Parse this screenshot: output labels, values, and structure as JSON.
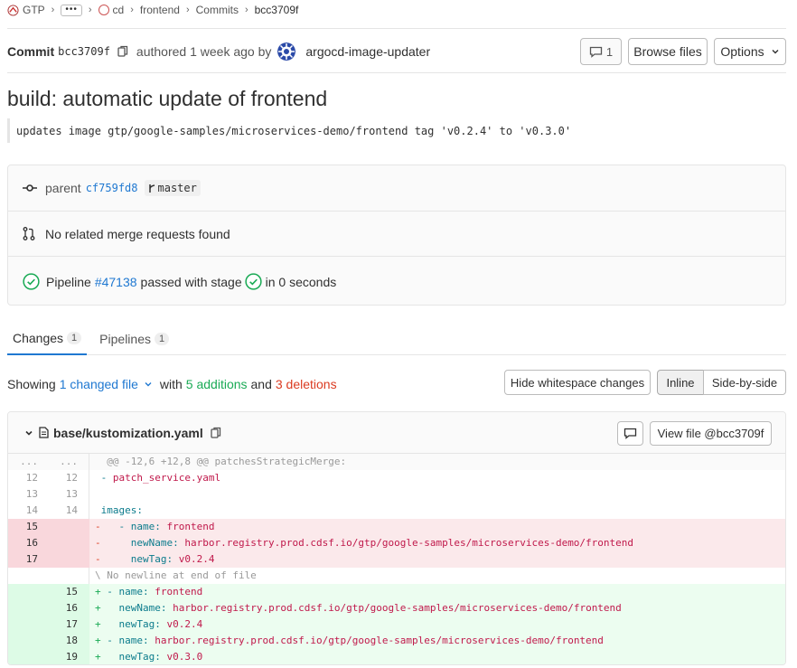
{
  "breadcrumb": {
    "group": "GTP",
    "ellipsis": "•••",
    "project_owner": "cd",
    "project": "frontend",
    "section": "Commits",
    "current": "bcc3709f"
  },
  "commit": {
    "label": "Commit",
    "sha": "bcc3709f",
    "authored": "authored 1 week ago by",
    "author": "argocd-image-updater",
    "comments_count": "1",
    "browse_files": "Browse files",
    "options": "Options",
    "title": "build: automatic update of frontend",
    "description": "updates image gtp/google-samples/microservices-demo/frontend tag 'v0.2.4' to 'v0.3.0'"
  },
  "info": {
    "parent_label": "parent",
    "parent_sha": "cf759fd8",
    "branch": "master",
    "merge_requests": "No related merge requests found",
    "pipeline_prefix": "Pipeline",
    "pipeline_id": "#47138",
    "pipeline_mid": "passed with stage",
    "pipeline_suffix": "in 0 seconds"
  },
  "tabs": [
    {
      "label": "Changes",
      "count": "1"
    },
    {
      "label": "Pipelines",
      "count": "1"
    }
  ],
  "summary": {
    "showing": "Showing",
    "changed_files": "1 changed file",
    "with": "with",
    "additions": "5 additions",
    "and": "and",
    "deletions": "3 deletions",
    "hide_whitespace": "Hide whitespace changes",
    "inline": "Inline",
    "side_by_side": "Side-by-side"
  },
  "file": {
    "path": "base/kustomization.yaml",
    "view_file": "View file @bcc3709f"
  },
  "diff": {
    "hunk_header": "@@ -12,6 +12,8 @@ patchesStrategicMerge:",
    "no_newline": "\\ No newline at end of file",
    "lines": [
      {
        "type": "match",
        "old": "...",
        "new": "...",
        "sign": "",
        "key": "",
        "val": ""
      },
      {
        "type": "context",
        "old": "12",
        "new": "12",
        "sign": "",
        "key": "- ",
        "val": "patch_service.yaml"
      },
      {
        "type": "context",
        "old": "13",
        "new": "13",
        "sign": "",
        "key": "",
        "val": ""
      },
      {
        "type": "context",
        "old": "14",
        "new": "14",
        "sign": "",
        "key": "images:",
        "val": ""
      },
      {
        "type": "old",
        "old": "15",
        "new": "",
        "sign": "-",
        "key": "  - name: ",
        "val": "frontend"
      },
      {
        "type": "old",
        "old": "16",
        "new": "",
        "sign": "-",
        "key": "    newName: ",
        "val": "harbor.registry.prod.cdsf.io/gtp/google-samples/microservices-demo/frontend"
      },
      {
        "type": "old",
        "old": "17",
        "new": "",
        "sign": "-",
        "key": "    newTag: ",
        "val": "v0.2.4"
      },
      {
        "type": "nonl",
        "old": "",
        "new": "",
        "sign": "",
        "key": "",
        "val": ""
      },
      {
        "type": "new",
        "old": "",
        "new": "15",
        "sign": "+",
        "key": "- name: ",
        "val": "frontend"
      },
      {
        "type": "new",
        "old": "",
        "new": "16",
        "sign": "+",
        "key": "  newName: ",
        "val": "harbor.registry.prod.cdsf.io/gtp/google-samples/microservices-demo/frontend"
      },
      {
        "type": "new",
        "old": "",
        "new": "17",
        "sign": "+",
        "key": "  newTag: ",
        "val": "v0.2.4"
      },
      {
        "type": "new",
        "old": "",
        "new": "18",
        "sign": "+",
        "key": "- name: ",
        "val": "harbor.registry.prod.cdsf.io/gtp/google-samples/microservices-demo/frontend"
      },
      {
        "type": "new",
        "old": "",
        "new": "19",
        "sign": "+",
        "key": "  newTag: ",
        "val": "v0.3.0"
      }
    ]
  },
  "colors": {
    "link": "#1f78d1",
    "addition": "#1aaa55",
    "deletion": "#db3b21",
    "pipeline_success": "#1aaa55"
  }
}
